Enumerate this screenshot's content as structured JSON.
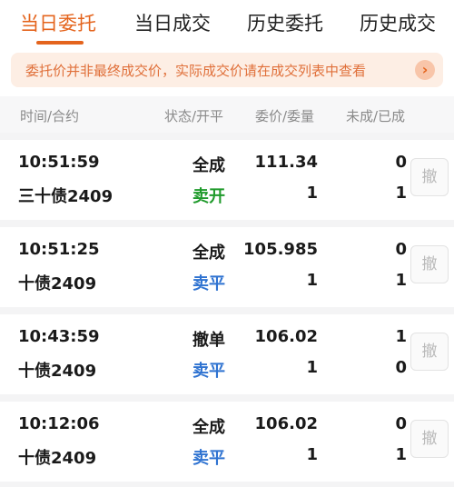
{
  "tabs": [
    {
      "label": "当日委托",
      "active": true
    },
    {
      "label": "当日成交",
      "active": false
    },
    {
      "label": "历史委托",
      "active": false
    },
    {
      "label": "历史成交",
      "active": false
    }
  ],
  "notice": {
    "text": "委托价并非最终成交价，实际成交价请在成交列表中查看",
    "arrow_icon": "chevron-right-icon"
  },
  "table": {
    "headers": [
      "时间/合约",
      "状态/开平",
      "委价/委量",
      "未成/已成"
    ],
    "cancel_label": "撤",
    "rows": [
      {
        "time": "10:51:59",
        "contract": "三十债2409",
        "status": "全成",
        "action": "卖开",
        "action_color": "#1f9a2b",
        "price": "111.34",
        "qty": "1",
        "unfilled": "0",
        "filled": "1"
      },
      {
        "time": "10:51:25",
        "contract": "十债2409",
        "status": "全成",
        "action": "卖平",
        "action_color": "#2f73d1",
        "price": "105.985",
        "qty": "1",
        "unfilled": "0",
        "filled": "1"
      },
      {
        "time": "10:43:59",
        "contract": "十债2409",
        "status": "撤单",
        "action": "卖平",
        "action_color": "#2f73d1",
        "price": "106.02",
        "qty": "1",
        "unfilled": "1",
        "filled": "0"
      },
      {
        "time": "10:12:06",
        "contract": "十债2409",
        "status": "全成",
        "action": "卖平",
        "action_color": "#2f73d1",
        "price": "106.02",
        "qty": "1",
        "unfilled": "0",
        "filled": "1"
      }
    ]
  },
  "colors": {
    "accent": "#e4641d",
    "sell_open": "#1f9a2b",
    "sell_close": "#2f73d1"
  }
}
